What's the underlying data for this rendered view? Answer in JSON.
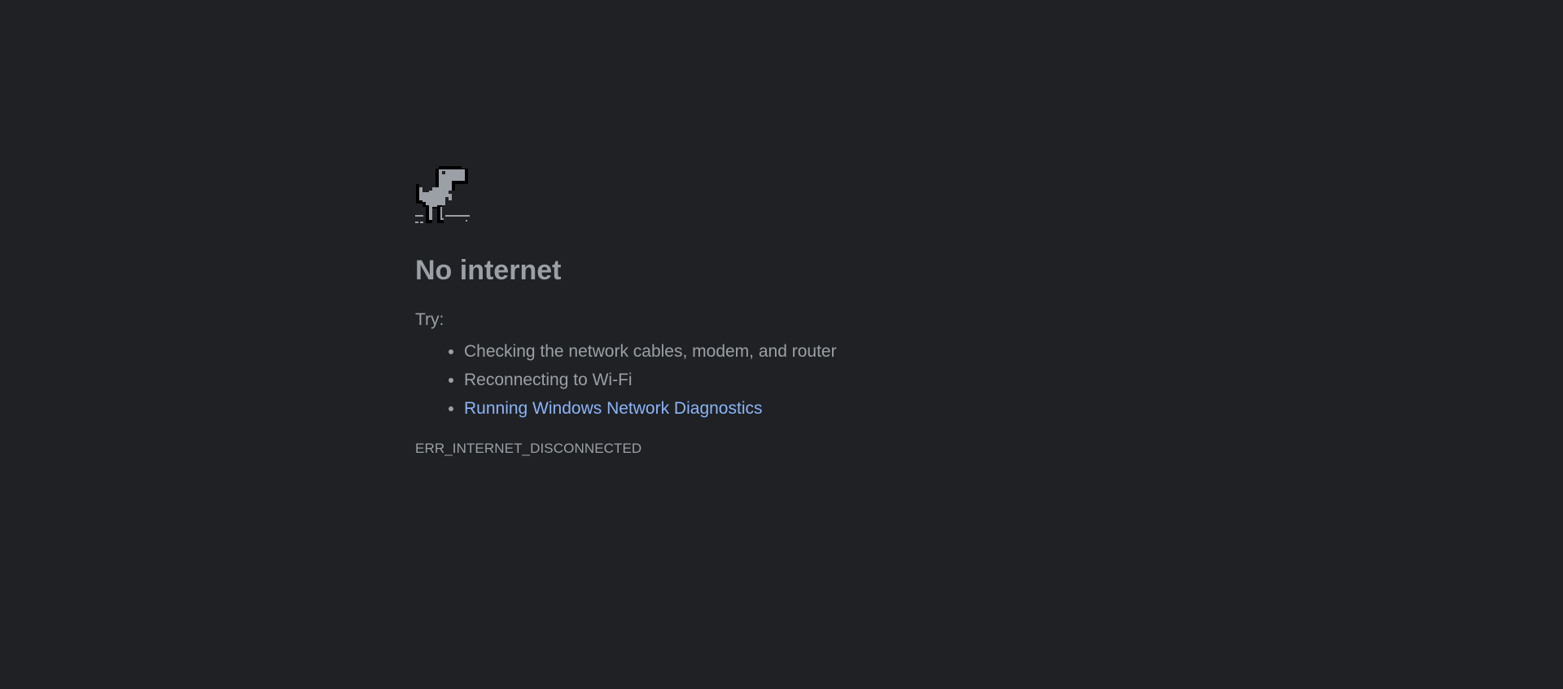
{
  "error_page": {
    "icon": "offline-dinosaur-icon",
    "title": "No internet",
    "try_label": "Try:",
    "suggestions": [
      {
        "text": "Checking the network cables, modem, and router",
        "is_link": false
      },
      {
        "text": "Reconnecting to Wi-Fi",
        "is_link": false
      },
      {
        "text": "Running Windows Network Diagnostics",
        "is_link": true
      }
    ],
    "error_code": "ERR_INTERNET_DISCONNECTED"
  },
  "colors": {
    "background": "#202124",
    "text": "#9aa0a6",
    "link": "#8ab4f8"
  }
}
